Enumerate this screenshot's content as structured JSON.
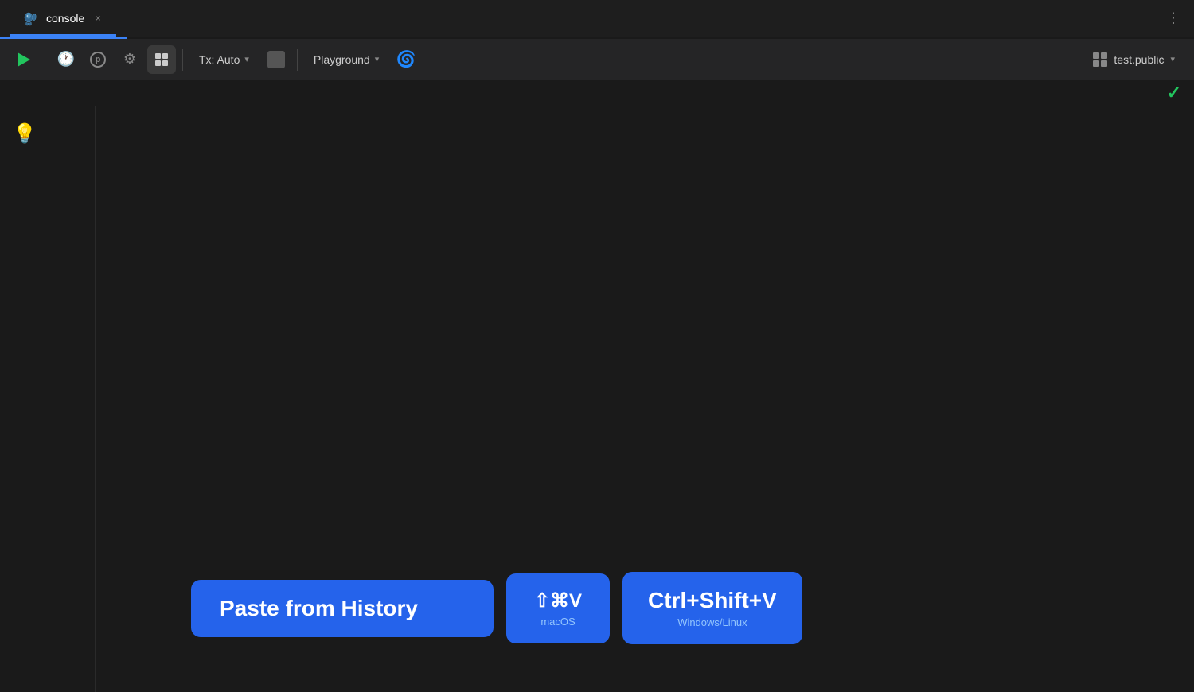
{
  "tab": {
    "title": "console",
    "close_label": "×"
  },
  "toolbar": {
    "run_label": "Run",
    "history_label": "History",
    "explain_label": "Explain",
    "settings_label": "Settings",
    "grid_label": "Grid View",
    "tx_label": "Tx: Auto",
    "stop_label": "Stop",
    "playground_label": "Playground",
    "ai_label": "AI",
    "schema_label": "test.public",
    "more_label": "⋮"
  },
  "editor": {
    "checkmark": "✓",
    "lightbulb": "💡"
  },
  "hint": {
    "main_label": "Paste from History",
    "macos_keys": "⇧⌘V",
    "macos_os": "macOS",
    "winlinux_keys": "Ctrl+Shift+V",
    "winlinux_os": "Windows/Linux"
  }
}
